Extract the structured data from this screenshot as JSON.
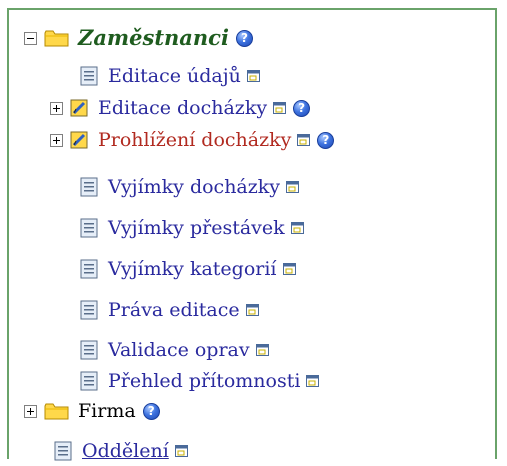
{
  "tree": {
    "root": {
      "label": "Zaměstnanci",
      "help_glyph": "?",
      "children": [
        {
          "label": "Editace údajů"
        },
        {
          "label": "Editace docházky",
          "help_glyph": "?"
        },
        {
          "label": "Prohlížení docházky",
          "help_glyph": "?"
        },
        {
          "label": "Vyjímky docházky"
        },
        {
          "label": "Vyjímky přestávek"
        },
        {
          "label": "Vyjímky kategorií"
        },
        {
          "label": "Práva editace"
        },
        {
          "label": "Validace oprav"
        },
        {
          "label": "Přehled přítomnosti"
        }
      ]
    },
    "firma": {
      "label": "Firma",
      "help_glyph": "?"
    },
    "partial": {
      "label": "Oddělení"
    }
  },
  "colors": {
    "border": "#6aa36a",
    "link": "#2a2a9e",
    "active_link": "#b12a20",
    "title": "#1f5c1f"
  },
  "icons": [
    "folder-icon",
    "folder-edit-icon",
    "page-icon",
    "new-window-icon",
    "help-icon",
    "collapse-icon",
    "expand-icon"
  ]
}
